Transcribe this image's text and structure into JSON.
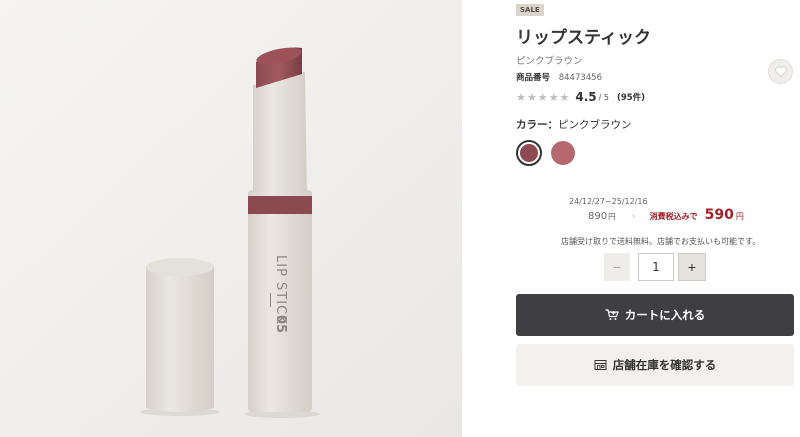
{
  "product": {
    "badge": "SALE",
    "title": "リップスティック",
    "subtitle": "ピンクブラウン",
    "code_label": "商品番号",
    "code_value": "84473456",
    "rating_value": "4.5",
    "rating_max": "/ 5",
    "review_count": "(95件)",
    "rating_stars": 4.5,
    "color_label": "カラー：",
    "color_value": "ピンクブラウン",
    "swatches": [
      "#8e4a52",
      "#b5686d"
    ],
    "image_text_brand": "LIP STICK",
    "image_text_number": "05"
  },
  "pricing": {
    "period": "24/12/27~25/12/16",
    "old_price": "890",
    "yen": "円",
    "tax_label": "消費税込みで",
    "new_price": "590",
    "accent_color": "#a1212a"
  },
  "notice": "店舗受け取りで送料無料。店舗でお支払いも可能です。",
  "quantity": {
    "minus": "−",
    "value": "1",
    "plus": "+"
  },
  "buttons": {
    "cart_label": "カートに入れる",
    "store_label": "店舗在庫を確認する"
  },
  "icons": {
    "favorite": "heart-icon",
    "cart": "cart-icon",
    "store": "store-icon",
    "star": "star-icon"
  }
}
